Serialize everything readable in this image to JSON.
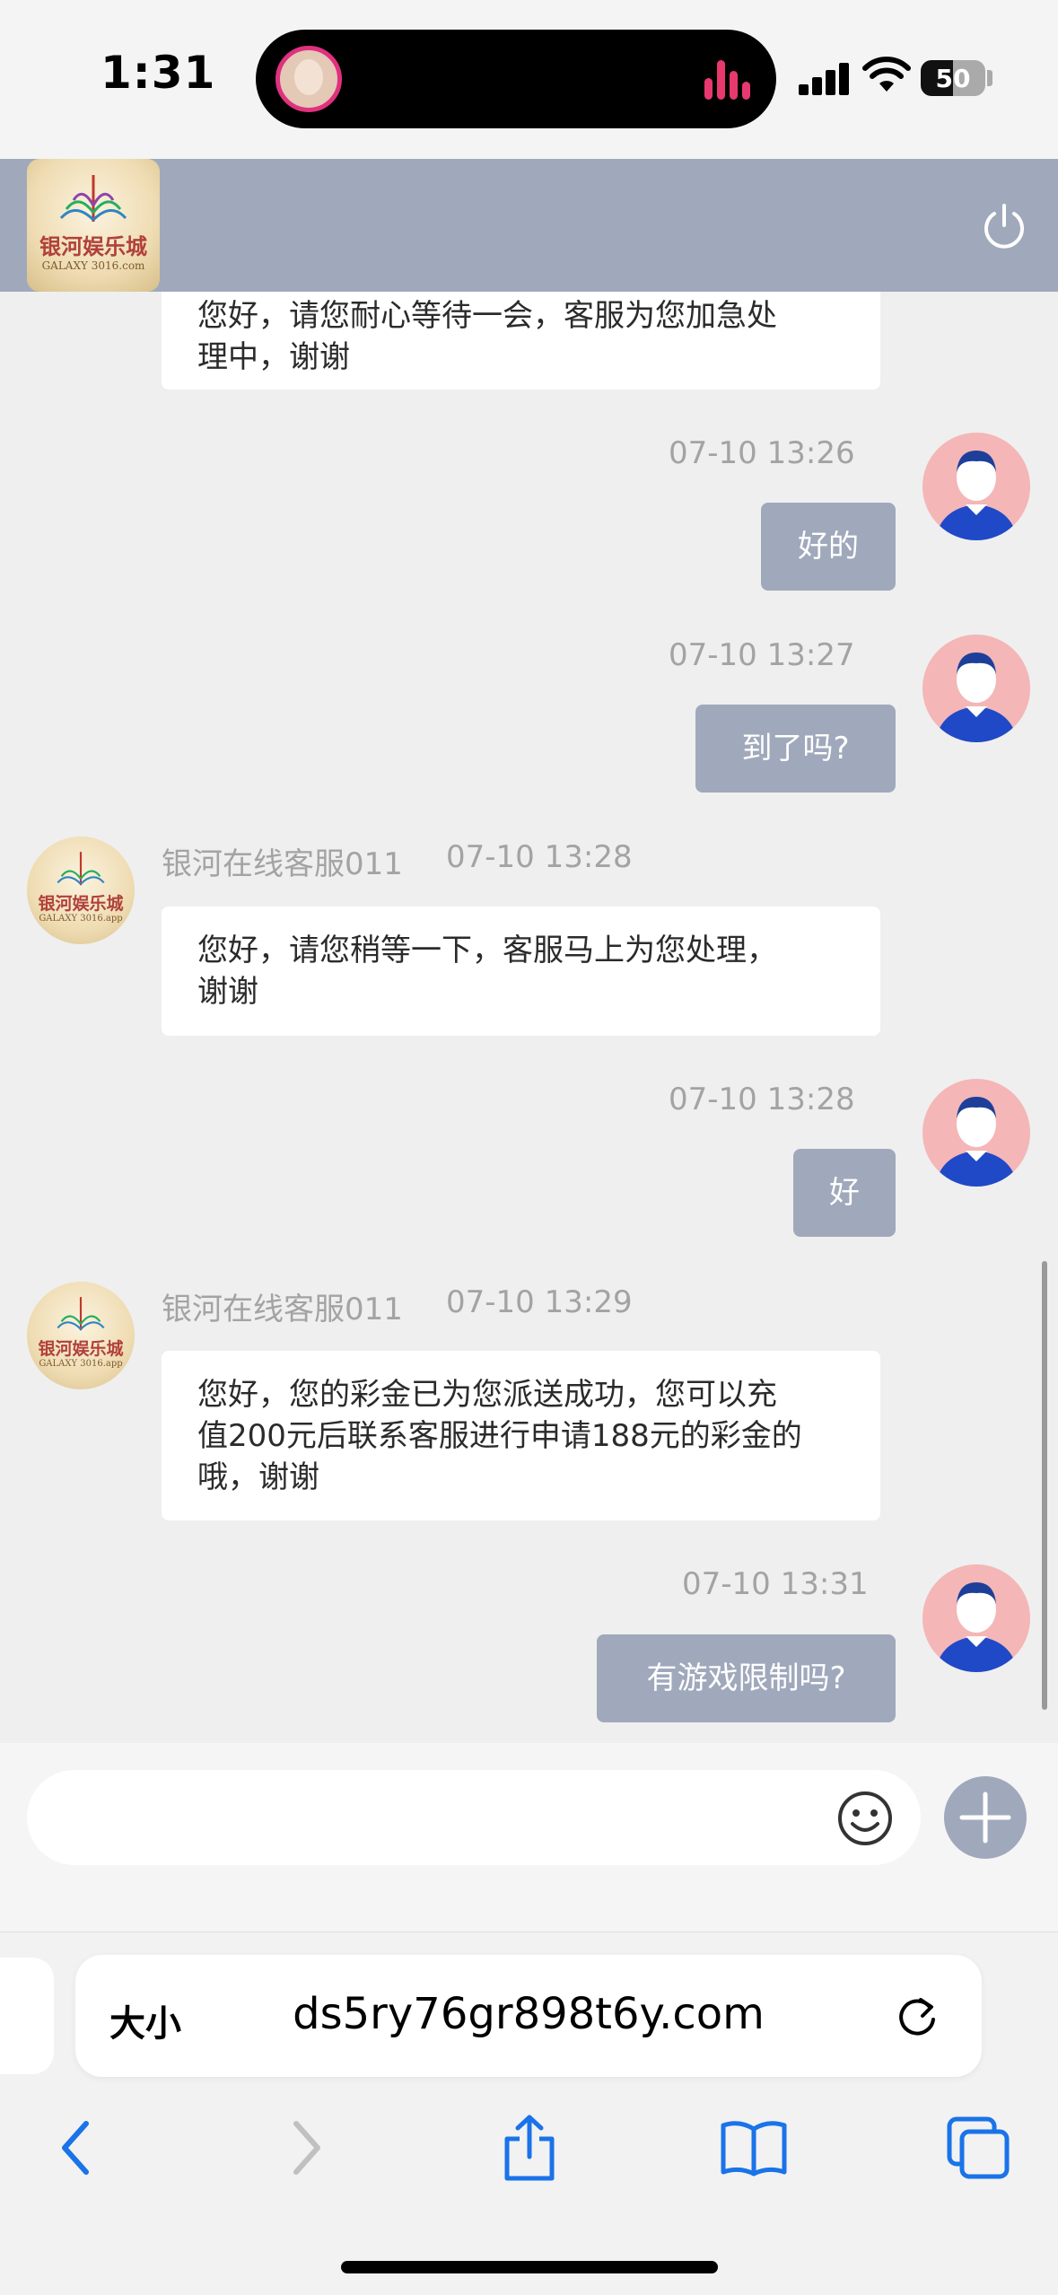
{
  "status_bar": {
    "time": "1:31",
    "battery": "50",
    "icons": [
      "cellular-signal-icon",
      "wifi-icon",
      "battery-icon",
      "audio-bars-icon"
    ]
  },
  "header": {
    "logo_text": "银河娱乐城",
    "logo_subtext": "GALAXY 3016.com",
    "power_icon": "power-icon",
    "bg_color": "#a0a9bb"
  },
  "messages": [
    {
      "side": "agent",
      "text_lines": [
        "您好，请您耐心等待一会，客服为您加急处",
        "理中，谢谢"
      ]
    },
    {
      "side": "user",
      "time": "07-10 13:26",
      "text": "好的"
    },
    {
      "side": "user",
      "time": "07-10 13:27",
      "text": "到了吗?"
    },
    {
      "side": "agent",
      "sender": "银河在线客服011",
      "time": "07-10 13:28",
      "text_lines": [
        "您好，请您稍等一下，客服马上为您处理，",
        "谢谢"
      ]
    },
    {
      "side": "user",
      "time": "07-10 13:28",
      "text": "好"
    },
    {
      "side": "agent",
      "sender": "银河在线客服011",
      "time": "07-10 13:29",
      "text_lines": [
        "您好，您的彩金已为您派送成功，您可以充",
        "值200元后联系客服进行申请188元的彩金的",
        "哦，谢谢"
      ]
    },
    {
      "side": "user",
      "time": "07-10 13:31",
      "text": "有游戏限制吗?"
    }
  ],
  "agent_avatar_text": "银河娱乐城",
  "agent_avatar_sub": "GALAXY 3016.app",
  "input": {
    "placeholder": "",
    "value": "",
    "emoji_icon": "smiley-icon",
    "add_icon": "plus-icon"
  },
  "safari": {
    "aa_label": "大小",
    "url": "ds5ry76gr898t6y.com",
    "icons": [
      "back-icon",
      "forward-icon",
      "share-icon",
      "bookmarks-icon",
      "tabs-icon",
      "reload-icon"
    ]
  }
}
